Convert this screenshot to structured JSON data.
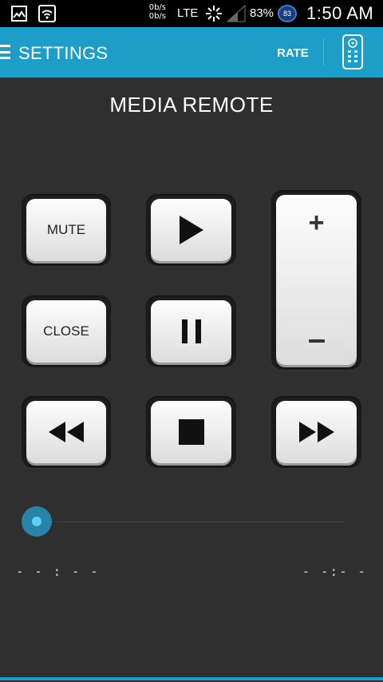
{
  "statusbar": {
    "net_up": "0b/s",
    "net_down": "0b/s",
    "network": "LTE",
    "battery": "83%",
    "badge": "83",
    "time": "1:50 AM"
  },
  "appbar": {
    "title": "SETTINGS",
    "rate_label": "RATE"
  },
  "main": {
    "title": "MEDIA REMOTE"
  },
  "controls": {
    "mute_label": "MUTE",
    "close_label": "CLOSE",
    "volume_up_label": "+"
  },
  "seekbar": {
    "progress": 0,
    "elapsed": "- - : - -",
    "total": "- -:- -"
  },
  "colors": {
    "accent": "#1c9ec8",
    "background": "#2f2f2f"
  }
}
